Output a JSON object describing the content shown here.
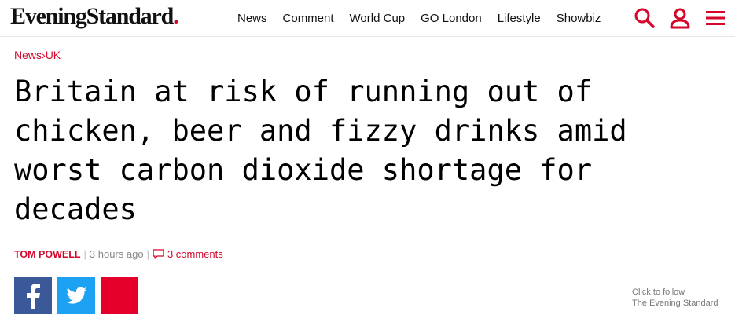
{
  "brand": {
    "name": "EveningStandard",
    "dot": ".",
    "accent": "#d6062b"
  },
  "nav": [
    "News",
    "Comment",
    "World Cup",
    "GO London",
    "Lifestyle",
    "Showbiz"
  ],
  "header_icons": [
    "search-icon",
    "user-icon",
    "menu-icon"
  ],
  "breadcrumb": {
    "section": "News",
    "separator": "›",
    "subsection": "UK"
  },
  "article": {
    "headline": "Britain at risk of running out of chicken, beer and fizzy drinks amid worst carbon dioxide shortage for decades",
    "author": "TOM POWELL",
    "time": "3 hours ago",
    "comments": "3 comments"
  },
  "share": {
    "facebook_color": "#3b5998",
    "twitter_color": "#1da1f2",
    "third_color": "#e4002b"
  },
  "follow": {
    "line1": "Click to follow",
    "line2": "The Evening Standard"
  }
}
